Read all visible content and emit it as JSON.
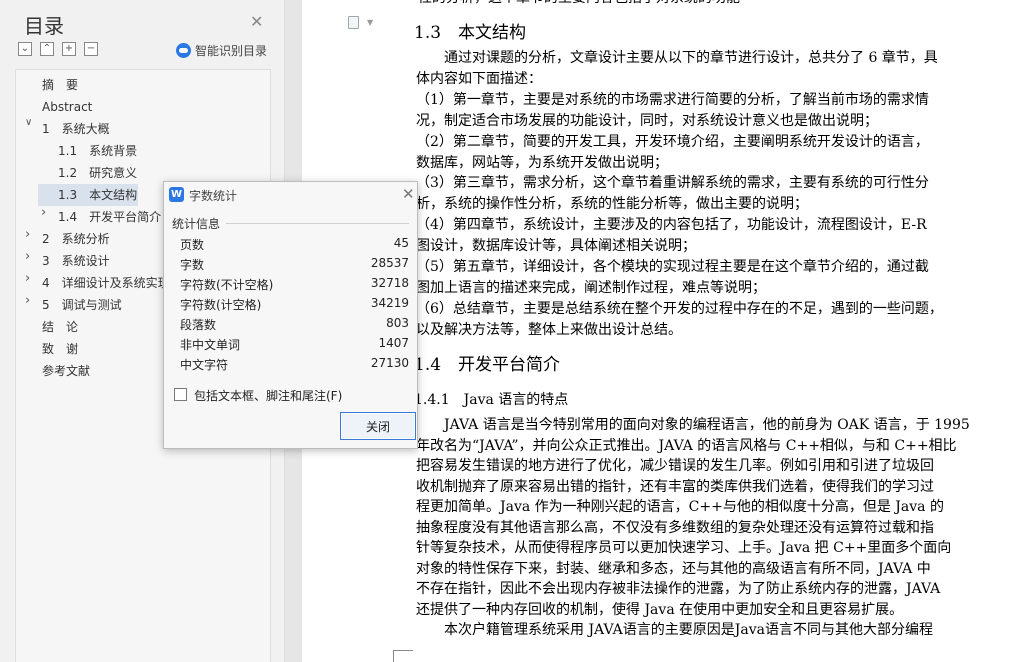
{
  "toc": {
    "title": "目录",
    "smart_label": "智能识别目录",
    "tool_icons": [
      "collapse-all-icon",
      "expand-all-icon",
      "add-level-icon",
      "remove-level-icon"
    ],
    "items": [
      {
        "label": "摘　要",
        "level": 0,
        "expander": ""
      },
      {
        "label": "Abstract",
        "level": 0,
        "expander": ""
      },
      {
        "label": "1　系统大概",
        "level": 0,
        "expander": "v"
      },
      {
        "label": "1.1　系统背景",
        "level": 1,
        "expander": ""
      },
      {
        "label": "1.2　研究意义",
        "level": 1,
        "expander": ""
      },
      {
        "label": "1.3　本文结构",
        "level": 1,
        "expander": "",
        "active": true
      },
      {
        "label": "1.4　开发平台简介",
        "level": 1,
        "expander": ">"
      },
      {
        "label": "2　系统分析",
        "level": 0,
        "expander": ">"
      },
      {
        "label": "3　系统设计",
        "level": 0,
        "expander": ">"
      },
      {
        "label": "4　详细设计及系统实现",
        "level": 0,
        "expander": ">"
      },
      {
        "label": "5　调试与测试",
        "level": 0,
        "expander": ">"
      },
      {
        "label": "结　论",
        "level": 0,
        "expander": ""
      },
      {
        "label": "致　谢",
        "level": 0,
        "expander": ""
      },
      {
        "label": "参考文献",
        "level": 0,
        "expander": ""
      }
    ]
  },
  "document": {
    "top_partial": "性的分析，这个章节的主要内容包括了对系统的功能",
    "heading_13": "1.3　本文结构",
    "lines_13": [
      "　　通过对课题的分析，文章设计主要从以下的章节进行设计，总共分了 6 章节，具",
      "体内容如下面描述：",
      "（1）第一章节，主要是对系统的市场需求进行简要的分析，了解当前市场的需求情",
      "况，制定适合市场发展的功能设计，同时，对系统设计意义也是做出说明；",
      "（2）第二章节，简要的开发工具，开发环境介绍，主要阐明系统开发设计的语言，",
      "数据库，网站等，为系统开发做出说明；",
      "（3）第三章节，需求分析，这个章节着重讲解系统的需求，主要有系统的可行性分",
      "析，系统的操作性分析，系统的性能分析等，做出主要的说明；",
      "（4）第四章节，系统设计，主要涉及的内容包括了，功能设计，流程图设计，E-R",
      "图设计，数据库设计等，具体阐述相关说明；",
      "（5）第五章节，详细设计，各个模块的实现过程主要是在这个章节介绍的，通过截",
      "图加上语言的描述来完成，阐述制作过程，难点等说明；",
      "（6）总结章节，主要是总结系统在整个开发的过程中存在的不足，遇到的一些问题，",
      "以及解决方法等，整体上来做出设计总结。"
    ],
    "heading_14": "1.4　开发平台简介",
    "heading_141": "1.4.1　Java 语言的特点",
    "lines_141": [
      "　　JAVA 语言是当今特别常用的面向对象的编程语言，他的前身为 OAK 语言，于 1995",
      "年改名为“JAVA”，并向公众正式推出。JAVA 的语言风格与 C++相似，与和 C++相比",
      "把容易发生错误的地方进行了优化，减少错误的发生几率。例如引用和引进了垃圾回",
      "收机制抛弃了原来容易出错的指针，还有丰富的类库供我们选着，使得我们的学习过",
      "程更加简单。Java 作为一种刚兴起的语言，C++与他的相似度十分高，但是 Java 的",
      "抽象程度没有其他语言那么高，不仅没有多维数组的复杂处理还没有运算符过载和指",
      "针等复杂技术，从而使得程序员可以更加快速学习、上手。Java 把 C++里面多个面向",
      "对象的特性保存下来，封装、继承和多态，还与其他的高级语言有所不同，JAVA 中",
      "不存在指针，因此不会出现内存被非法操作的泄露，为了防止系统内存的泄露，JAVA",
      "还提供了一种内存回收的机制，使得 Java 在使用中更加安全和且更容易扩展。",
      "　　本次户籍管理系统采用 JAVA语言的主要原因是Java语言不同与其他大部分编程"
    ]
  },
  "dialog": {
    "title": "字数统计",
    "icon_letter": "W",
    "section_label": "统计信息",
    "stats": [
      {
        "label": "页数",
        "value": "45"
      },
      {
        "label": "字数",
        "value": "28537"
      },
      {
        "label": "字符数(不计空格)",
        "value": "32718"
      },
      {
        "label": "字符数(计空格)",
        "value": "34219"
      },
      {
        "label": "段落数",
        "value": "803"
      },
      {
        "label": "非中文单词",
        "value": "1407"
      },
      {
        "label": "中文字符",
        "value": "27130"
      }
    ],
    "checkbox_label": "包括文本框、脚注和尾注(F)",
    "checkbox_checked": false,
    "close_label": "关闭"
  },
  "colors": {
    "accent": "#2b78e4",
    "active_item": "#d9e1ed",
    "button_border": "#3b78d8"
  }
}
